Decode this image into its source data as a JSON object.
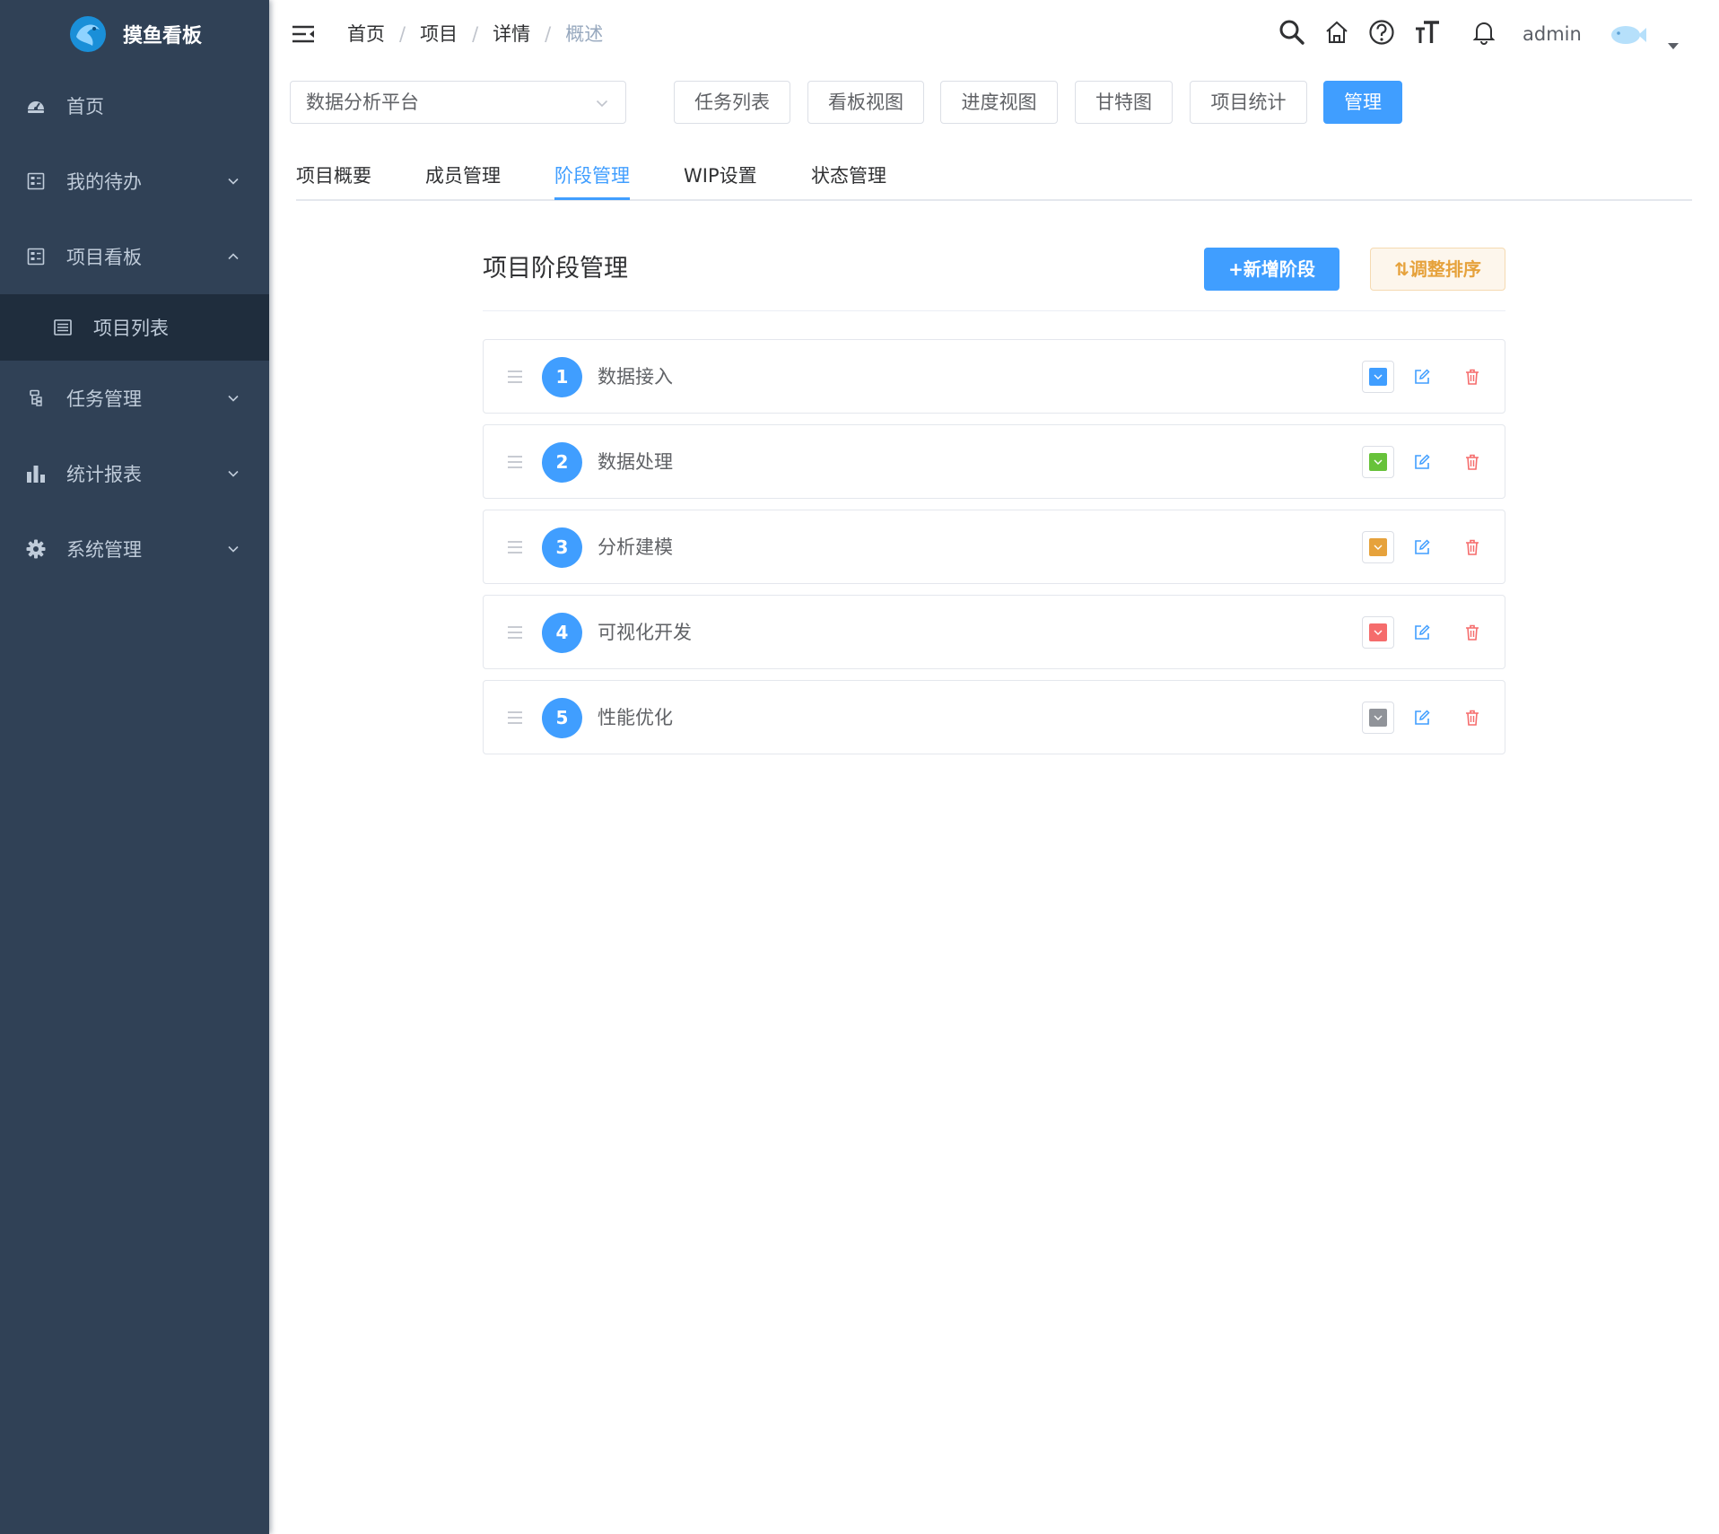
{
  "app": {
    "title": "摸鱼看板"
  },
  "sidebar": {
    "items": [
      {
        "label": "首页",
        "icon": "dashboard-icon",
        "has_children": false
      },
      {
        "label": "我的待办",
        "icon": "form-icon",
        "has_children": true,
        "expanded": false
      },
      {
        "label": "项目看板",
        "icon": "form-icon",
        "has_children": true,
        "expanded": true,
        "children": [
          {
            "label": "项目列表",
            "icon": "list-icon",
            "active": true
          }
        ]
      },
      {
        "label": "任务管理",
        "icon": "tree-icon",
        "has_children": true,
        "expanded": false
      },
      {
        "label": "统计报表",
        "icon": "bar-chart-icon",
        "has_children": true,
        "expanded": false
      },
      {
        "label": "系统管理",
        "icon": "gear-icon",
        "has_children": true,
        "expanded": false
      }
    ]
  },
  "header": {
    "breadcrumb": [
      "首页",
      "项目",
      "详情",
      "概述"
    ],
    "username": "admin"
  },
  "toolbar": {
    "project_select": "数据分析平台",
    "buttons": [
      "任务列表",
      "看板视图",
      "进度视图",
      "甘特图",
      "项目统计",
      "管理"
    ],
    "active_button": "管理"
  },
  "tabs": {
    "items": [
      "项目概要",
      "成员管理",
      "阶段管理",
      "WIP设置",
      "状态管理"
    ],
    "active": "阶段管理"
  },
  "stages_panel": {
    "title": "项目阶段管理",
    "add_label": "+新增阶段",
    "sort_label": "调整排序",
    "stages": [
      {
        "order": "1",
        "name": "数据接入",
        "color": "#409eff"
      },
      {
        "order": "2",
        "name": "数据处理",
        "color": "#67c23a"
      },
      {
        "order": "3",
        "name": "分析建模",
        "color": "#e6a23c"
      },
      {
        "order": "4",
        "name": "可视化开发",
        "color": "#f56c6c"
      },
      {
        "order": "5",
        "name": "性能优化",
        "color": "#909399"
      }
    ]
  },
  "colors": {
    "sidebar_bg": "#304156",
    "submenu_bg": "#1f2d3d",
    "primary": "#409eff",
    "warning": "#e6a23c",
    "danger": "#f56c6c"
  }
}
